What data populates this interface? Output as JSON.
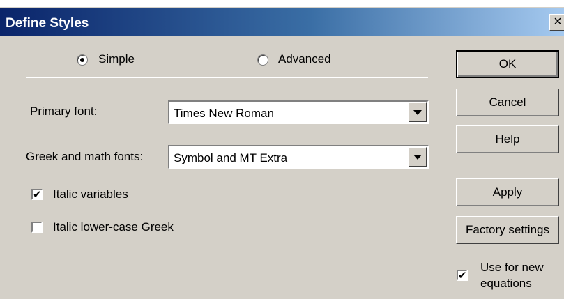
{
  "window": {
    "title": "Define Styles",
    "close_label": "×"
  },
  "mode": {
    "simple_label": "Simple",
    "advanced_label": "Advanced",
    "selected": "simple"
  },
  "primary_font": {
    "label": "Primary font:",
    "value": "Times New Roman"
  },
  "greek_font": {
    "label": "Greek and math fonts:",
    "value": "Symbol and MT Extra"
  },
  "options": {
    "italic_variables": {
      "label": "Italic variables",
      "checked": true
    },
    "italic_lower_greek": {
      "label": "Italic lower-case Greek",
      "checked": false
    }
  },
  "buttons": {
    "ok": "OK",
    "cancel": "Cancel",
    "help": "Help",
    "apply": "Apply",
    "factory": "Factory settings"
  },
  "use_for_new": {
    "label_line1": "Use for new",
    "label_line2": "equations",
    "checked": true
  }
}
